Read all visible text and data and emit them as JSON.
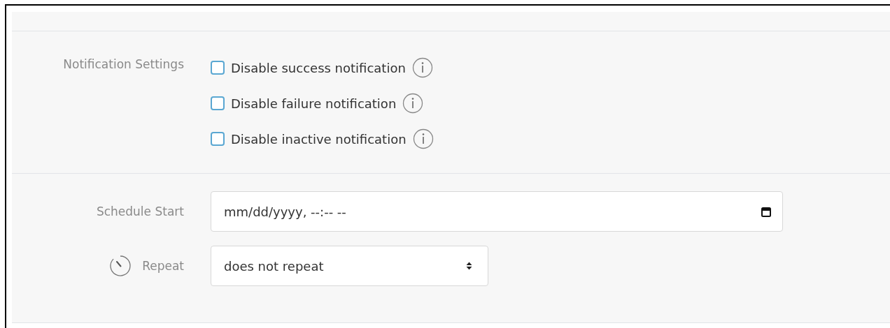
{
  "notification_settings": {
    "label": "Notification Settings",
    "options": [
      {
        "label": "Disable success notification",
        "checked": false
      },
      {
        "label": "Disable failure notification",
        "checked": false
      },
      {
        "label": "Disable inactive notification",
        "checked": false
      }
    ]
  },
  "schedule_start": {
    "label": "Schedule Start",
    "placeholder": "mm/dd/yyyy, --:-- --"
  },
  "repeat": {
    "label": "Repeat",
    "value": "does not repeat"
  }
}
